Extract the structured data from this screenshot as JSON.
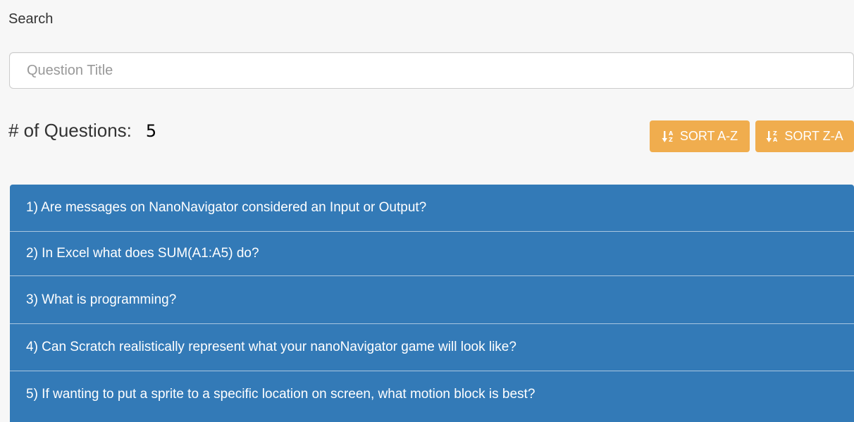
{
  "search": {
    "label": "Search",
    "placeholder": "Question Title",
    "value": ""
  },
  "summary": {
    "count_label": "# of Questions:",
    "count": "5"
  },
  "sort": {
    "az_label": "SORT A-Z",
    "za_label": "SORT Z-A",
    "icon": "sort-alpha-icon"
  },
  "questions": [
    "1) Are messages on NanoNavigator considered an Input or Output?",
    "2) In Excel what does SUM(A1:A5) do?",
    "3) What is programming?",
    "4) Can Scratch realistically represent what your nanoNavigator game will look like?",
    "5) If wanting to put a sprite to a specific location on screen, what motion block is best?"
  ],
  "colors": {
    "list_background": "#337ab7",
    "button_background": "#f0ad4e",
    "page_background": "#f7f7f7"
  }
}
